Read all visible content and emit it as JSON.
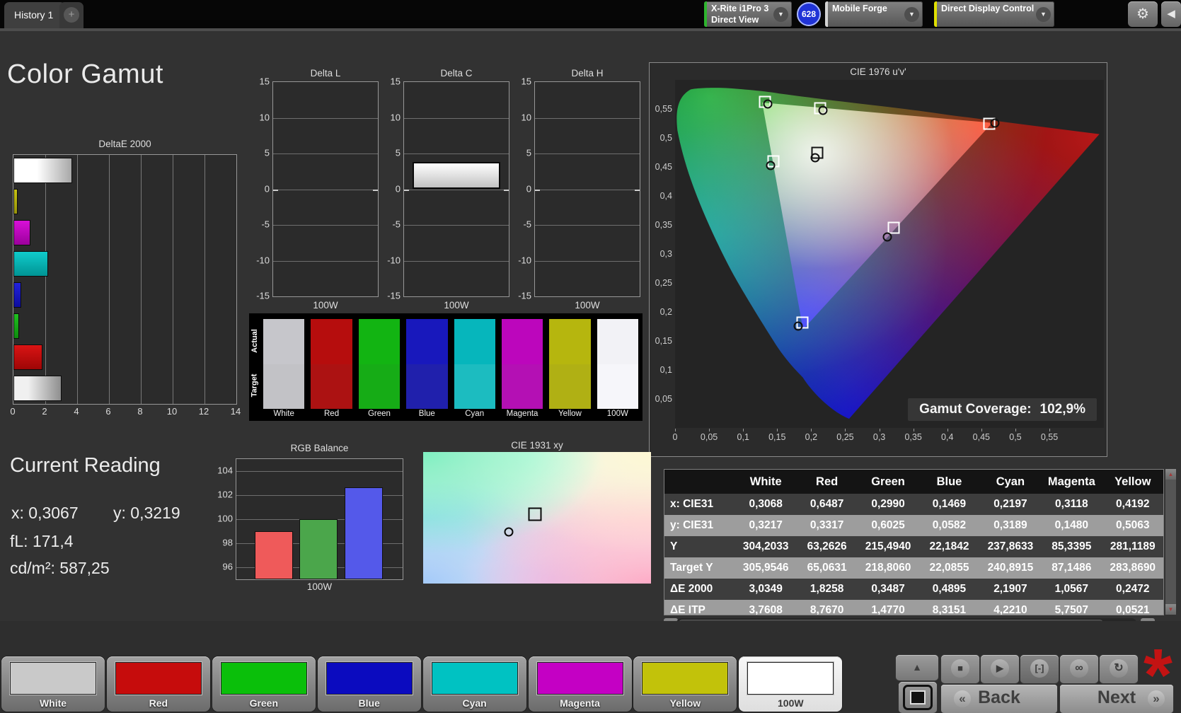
{
  "header": {
    "tab_label": "History 1",
    "add_tab_label": "+",
    "meter_dropdown": {
      "line1": "X-Rite i1Pro 3",
      "line2": "Direct View",
      "badge": "628",
      "accent": "#2eb52e"
    },
    "source_dropdown": {
      "label": "Mobile Forge",
      "accent": "#d4d4d4"
    },
    "workflow_dropdown": {
      "label": "Direct Display Control",
      "accent": "#e0e000"
    }
  },
  "page_title": "Color Gamut",
  "current_reading": {
    "title": "Current Reading",
    "x_text": "x: 0,3067",
    "y_text": "y: 0,3219",
    "fl_text": "fL: 171,4",
    "cd_text": "cd/m²: 587,25"
  },
  "chart_data": [
    {
      "id": "deltae2000",
      "type": "bar",
      "orientation": "horizontal",
      "title": "DeltaE 2000",
      "categories": [
        "100W",
        "Yellow",
        "Magenta",
        "Cyan",
        "Blue",
        "Green",
        "Red",
        "White"
      ],
      "values": [
        3.7,
        0.2472,
        1.0567,
        2.1907,
        0.4895,
        0.3487,
        1.8258,
        3.0349
      ],
      "colors": [
        "white-gradient",
        "yellow",
        "magenta",
        "cyan",
        "blue",
        "green",
        "red",
        "silver-gradient"
      ],
      "xlim": [
        0,
        14
      ],
      "x_ticks": [
        "0",
        "2",
        "4",
        "6",
        "8",
        "10",
        "12",
        "14"
      ],
      "grid": true
    },
    {
      "id": "delta_l",
      "type": "bar",
      "title": "Delta L",
      "categories": [
        "100W"
      ],
      "values": [
        0
      ],
      "ylim": [
        -15,
        15
      ],
      "y_ticks": [
        "15",
        "10",
        "5",
        "0",
        "-5",
        "-10",
        "-15"
      ],
      "xlabel": "100W",
      "grid": true
    },
    {
      "id": "delta_c",
      "type": "bar",
      "title": "Delta C",
      "categories": [
        "100W"
      ],
      "values": [
        3.8
      ],
      "ylim": [
        -15,
        15
      ],
      "y_ticks": [
        "15",
        "10",
        "5",
        "0",
        "-5",
        "-10",
        "-15"
      ],
      "xlabel": "100W",
      "grid": true
    },
    {
      "id": "delta_h",
      "type": "bar",
      "title": "Delta H",
      "categories": [
        "100W"
      ],
      "values": [
        0
      ],
      "ylim": [
        -15,
        15
      ],
      "y_ticks": [
        "15",
        "10",
        "5",
        "0",
        "-5",
        "-10",
        "-15"
      ],
      "xlabel": "100W",
      "grid": true
    },
    {
      "id": "rgb_balance",
      "type": "bar",
      "title": "RGB Balance",
      "categories": [
        "Red",
        "Green",
        "Blue"
      ],
      "values": [
        99.0,
        100.0,
        102.65
      ],
      "colors": [
        "#ef5a5a",
        "#4ba64b",
        "#5459ea"
      ],
      "ylim": [
        95,
        105
      ],
      "y_ticks": [
        "104",
        "102",
        "100",
        "98",
        "96"
      ],
      "xlabel": "100W",
      "grid": true
    },
    {
      "id": "cie1976",
      "type": "scatter",
      "title": "CIE 1976 u'v'",
      "u_max": 0.63,
      "v_max": 0.6,
      "x_ticks": [
        "0",
        "0,05",
        "0,1",
        "0,15",
        "0,2",
        "0,25",
        "0,3",
        "0,35",
        "0,4",
        "0,45",
        "0,5",
        "0,55"
      ],
      "y_ticks": [
        "0,55",
        "0,5",
        "0,45",
        "0,4",
        "0,35",
        "0,3",
        "0,25",
        "0,2",
        "0,15",
        "0,1",
        "0,05"
      ],
      "coverage_label": "Gamut Coverage:",
      "coverage_value": "102,9%",
      "points": [
        {
          "name": "green",
          "u": 0.132,
          "v": 0.562,
          "mu": 0.136,
          "mv": 0.558
        },
        {
          "name": "yellow",
          "u": 0.213,
          "v": 0.551,
          "mu": 0.217,
          "mv": 0.547
        },
        {
          "name": "red",
          "u": 0.462,
          "v": 0.525,
          "mu": 0.47,
          "mv": 0.526
        },
        {
          "name": "white",
          "u": 0.209,
          "v": 0.474,
          "mu": 0.206,
          "mv": 0.466,
          "dark": true
        },
        {
          "name": "cyan",
          "u": 0.1445,
          "v": 0.46,
          "mu": 0.14,
          "mv": 0.453
        },
        {
          "name": "magenta",
          "u": 0.321,
          "v": 0.345,
          "mu": 0.312,
          "mv": 0.329
        },
        {
          "name": "blue",
          "u": 0.187,
          "v": 0.182,
          "mu": 0.181,
          "mv": 0.176
        }
      ]
    },
    {
      "id": "cie1931",
      "type": "scatter",
      "title": "CIE 1931 xy",
      "points": [
        {
          "name": "target",
          "shape": "square",
          "rx": 0.49,
          "ry": 0.475
        },
        {
          "name": "measured",
          "shape": "circle",
          "rx": 0.375,
          "ry": 0.605
        }
      ]
    }
  ],
  "swatch_panel": {
    "row_labels": [
      "Actual",
      "Target"
    ],
    "columns": [
      {
        "label": "White",
        "actual": "#c6c6cb",
        "target": "#c2c2c6"
      },
      {
        "label": "Red",
        "actual": "#b60d0d",
        "target": "#ac1212"
      },
      {
        "label": "Green",
        "actual": "#12b412",
        "target": "#16ac16"
      },
      {
        "label": "Blue",
        "actual": "#1818bc",
        "target": "#2020ac"
      },
      {
        "label": "Cyan",
        "actual": "#06b6bc",
        "target": "#1cbcc0"
      },
      {
        "label": "Magenta",
        "actual": "#bc06bc",
        "target": "#b410b4"
      },
      {
        "label": "Yellow",
        "actual": "#b6b60e",
        "target": "#b0b014"
      },
      {
        "label": "100W",
        "actual": "#f2f2f6",
        "target": "#f6f6fa"
      }
    ]
  },
  "table": {
    "headers": [
      "",
      "White",
      "Red",
      "Green",
      "Blue",
      "Cyan",
      "Magenta",
      "Yellow"
    ],
    "rows": [
      {
        "label": "x: CIE31",
        "values": [
          "0,3068",
          "0,6487",
          "0,2990",
          "0,1469",
          "0,2197",
          "0,3118",
          "0,4192"
        ]
      },
      {
        "label": "y: CIE31",
        "values": [
          "0,3217",
          "0,3317",
          "0,6025",
          "0,0582",
          "0,3189",
          "0,1480",
          "0,5063"
        ]
      },
      {
        "label": "Y",
        "values": [
          "304,2033",
          "63,2626",
          "215,4940",
          "22,1842",
          "237,8633",
          "85,3395",
          "281,1189"
        ]
      },
      {
        "label": "Target Y",
        "values": [
          "305,9546",
          "65,0631",
          "218,8060",
          "22,0855",
          "240,8915",
          "87,1486",
          "283,8690"
        ]
      },
      {
        "label": "ΔE 2000",
        "values": [
          "3,0349",
          "1,8258",
          "0,3487",
          "0,4895",
          "2,1907",
          "1,0567",
          "0,2472"
        ]
      },
      {
        "label": "ΔE ITP",
        "values": [
          "3,7608",
          "8,7670",
          "1,4770",
          "8,3151",
          "4,2210",
          "5,7507",
          "0,0521"
        ],
        "partial": true
      }
    ]
  },
  "footer": {
    "pattern_buttons": [
      {
        "label": "White",
        "color": "#c9c9c9"
      },
      {
        "label": "Red",
        "color": "#c60c0c"
      },
      {
        "label": "Green",
        "color": "#0abf0a"
      },
      {
        "label": "Blue",
        "color": "#0b0bbf"
      },
      {
        "label": "Cyan",
        "color": "#00c2c2"
      },
      {
        "label": "Magenta",
        "color": "#c400c4"
      },
      {
        "label": "Yellow",
        "color": "#c2c20a"
      },
      {
        "label": "100W",
        "color": "#ffffff",
        "selected": true
      }
    ],
    "back_label": "Back",
    "next_label": "Next"
  },
  "icons": {
    "add_tab": "+",
    "dropdown_arrow": "▼",
    "gear": "⚙",
    "collapse": "◀",
    "scroll_up": "▲",
    "scroll_down": "▼",
    "scroll_left": "◄",
    "scroll_right": "►",
    "pattern_up": "▲",
    "stop": "■",
    "play": "▶",
    "series": "[-]",
    "continuous": "∞",
    "loop": "↻",
    "back_chevron": "«",
    "next_chevron": "»",
    "asterisk": "*"
  }
}
